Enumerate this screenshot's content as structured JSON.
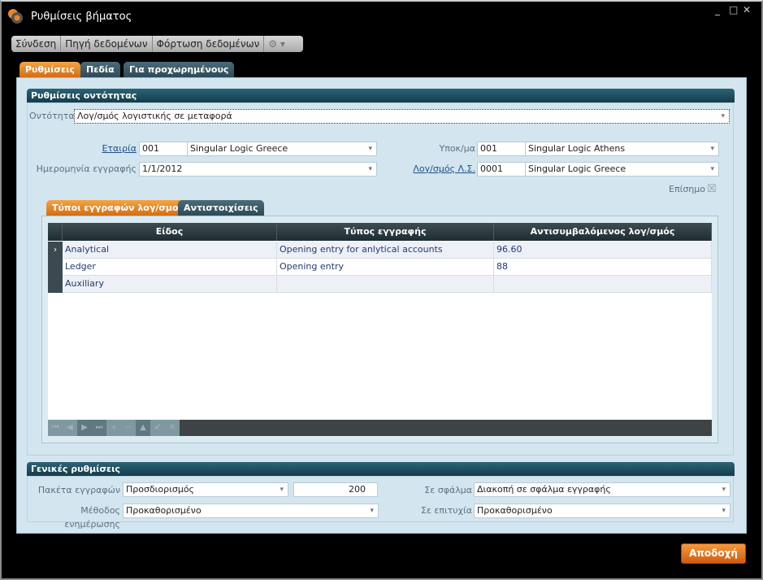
{
  "window": {
    "title": "Ρυθμίσεις βήματος",
    "controls": [
      "_",
      "□",
      "✕"
    ]
  },
  "toolbar": {
    "items": [
      "Σύνδεση",
      "Πηγή δεδομένων",
      "Φόρτωση δεδομένων"
    ],
    "gear": "⚙ ▾"
  },
  "tabs": [
    "Ρυθμίσεις",
    "Πεδία",
    "Για προχωρημένους"
  ],
  "entity": {
    "header": "Ρυθμίσεις οντότητας",
    "entity_label": "Οντότητα",
    "entity_value": "Λογ/σμός λογιστικής σε μεταφορά",
    "company_label": "Εταιρία",
    "company_code": "001",
    "company_name": "Singular Logic Greece",
    "branch_label": "Υποκ/μα",
    "branch_code": "001",
    "branch_name": "Singular Logic Athens",
    "date_label": "Ημερομηνία εγγραφής",
    "date_value": "1/1/2012",
    "account_label": "Λογ/σμός Λ.Σ.",
    "account_code": "0001",
    "account_name": "Singular Logic Greece",
    "official_label": "Επίσημο",
    "official_check": "☒"
  },
  "inner_tabs": [
    "Τύποι εγγραφών λογ/σμοί",
    "Αντιστοιχίσεις"
  ],
  "grid": {
    "columns": [
      "Είδος",
      "Τύπος εγγραφής",
      "Αντισυμβαλόμενος λογ/σμός"
    ],
    "rows": [
      [
        "Analytical",
        "Opening entry for anlytical accounts",
        "96.60"
      ],
      [
        "Ledger",
        "Opening entry",
        "88"
      ],
      [
        "Auxiliary",
        "",
        ""
      ]
    ],
    "current_marker": "›",
    "nav": [
      "⏮",
      "◀",
      "▶",
      "⏭",
      "+",
      "−",
      "▲",
      "✔",
      "✕"
    ]
  },
  "general": {
    "header": "Γενικές ρυθμίσεις",
    "packets_label": "Πακέτα εγγραφών",
    "packets_value": "Προσδιορισμός",
    "packets_count": "200",
    "method_label": "Μέθοδος ενημέρωσης",
    "method_value": "Προκαθορισμένο",
    "on_error_label": "Σε σφάλμα",
    "on_error_value": "Διακοπή σε σφάλμα εγγραφής",
    "on_success_label": "Σε επιτυχία",
    "on_success_value": "Προκαθορισμένο"
  },
  "accept_label": "Αποδοχή",
  "colors": {
    "accent": "#e07a22",
    "header": "#1e4a5a",
    "panel": "#d3e6ef"
  }
}
